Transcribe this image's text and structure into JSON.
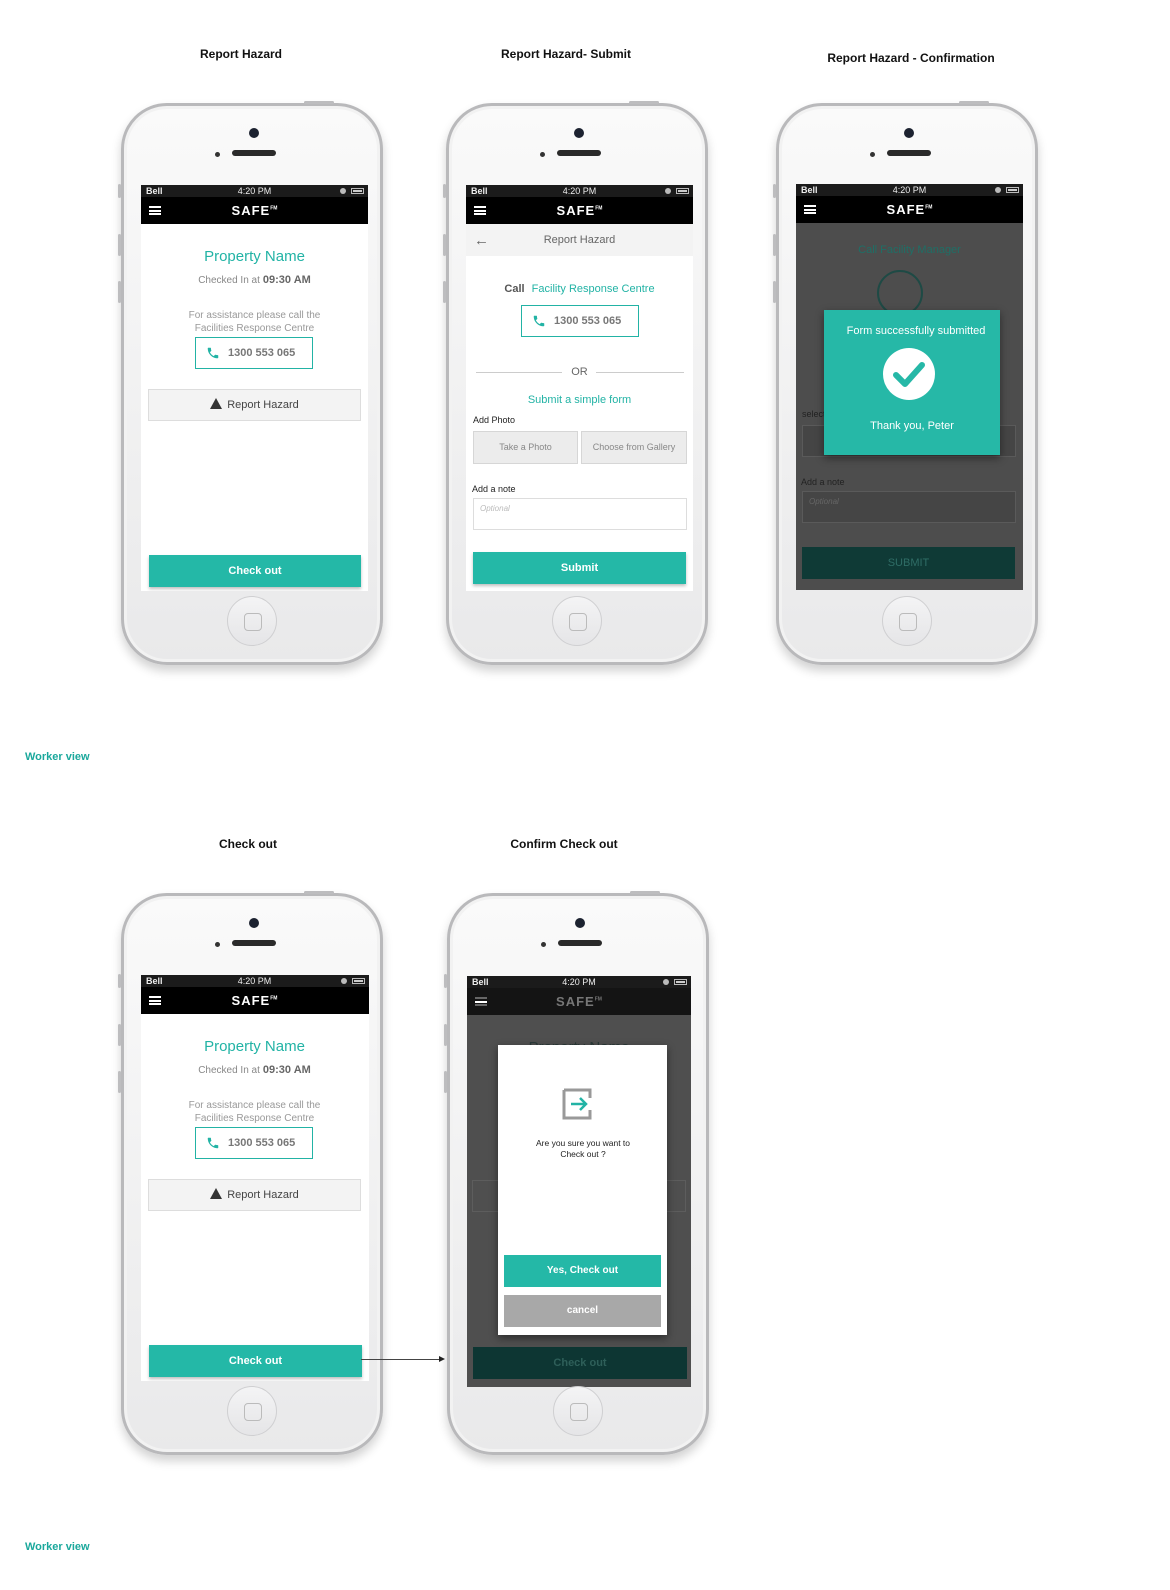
{
  "screens": {
    "s1": {
      "title": "Report Hazard"
    },
    "s2": {
      "title": "Report Hazard- Submit"
    },
    "s3": {
      "title": "Report Hazard - Confirmation"
    },
    "s4": {
      "title": "Check out"
    },
    "s5": {
      "title": "Confirm Check out"
    }
  },
  "sections": {
    "worker_view_1": "Worker view",
    "worker_view_2": "Worker view"
  },
  "status": {
    "carrier": "Bell",
    "time": "4:20 PM"
  },
  "app": {
    "logo": "SAFE",
    "logo_mark": "FM"
  },
  "home": {
    "property_name": "Property Name",
    "checked_in_label": "Checked In at",
    "checked_in_time": "09:30 AM",
    "assist_text": "For assistance please call the Facilities Response Centre",
    "phone": "1300 553 065",
    "report_hazard": "Report Hazard",
    "check_out": "Check out"
  },
  "report": {
    "header": "Report Hazard",
    "call_label": "Call",
    "call_target": "Facility Response Centre",
    "phone": "1300 553 065",
    "or": "OR",
    "simple_form": "Submit a simple form",
    "add_photo": "Add Photo",
    "take_photo": "Take a Photo",
    "choose_gallery": "Choose from Gallery",
    "add_note": "Add a note",
    "note_placeholder": "Optional",
    "submit": "Submit"
  },
  "confirmation": {
    "bg_call_manager": "Call Facility Manager",
    "bg_select": "select",
    "bg_add_note": "Add a note",
    "bg_placeholder": "Optional",
    "bg_submit": "SUBMIT",
    "dialog_title": "Form successfully submitted",
    "dialog_thanks": "Thank you, Peter"
  },
  "checkout_dialog": {
    "bg_property": "Property Name",
    "question": "Are you sure you want to Check out ?",
    "yes": "Yes, Check out",
    "cancel": "cancel",
    "bg_check_out": "Check out"
  },
  "colors": {
    "accent": "#24b8a7",
    "appbar": "#000000",
    "dim": "#4d4d4d"
  }
}
